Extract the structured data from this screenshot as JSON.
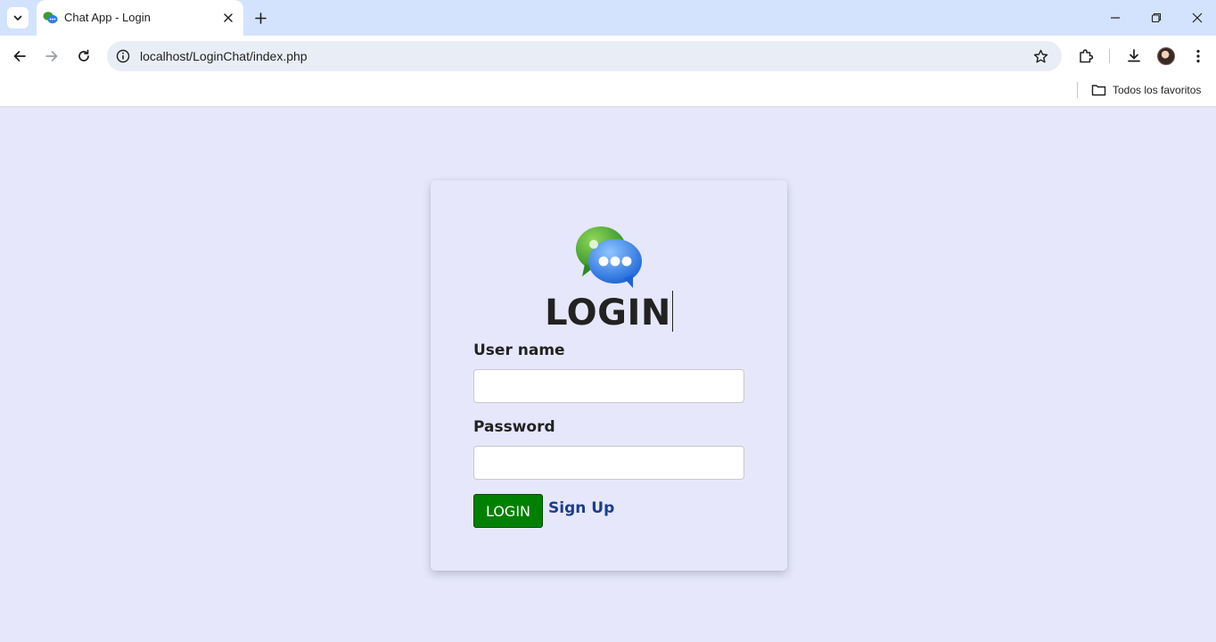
{
  "browser": {
    "tab_title": "Chat App - Login",
    "url": "localhost/LoginChat/index.php",
    "bookmarks_folder": "Todos los favoritos"
  },
  "page": {
    "heading": "LOGIN",
    "username_label": "User name",
    "username_value": "",
    "password_label": "Password",
    "password_value": "",
    "login_button": "LOGIN",
    "signup_link": "Sign Up"
  },
  "colors": {
    "page_background": "#e6e7fb",
    "login_button": "#008000",
    "signup_link": "#1a3e8c"
  },
  "icons": [
    "chevron-down-icon",
    "chat-bubbles-icon",
    "close-icon",
    "plus-icon",
    "minimize-icon",
    "restore-icon",
    "back-arrow-icon",
    "forward-arrow-icon",
    "reload-icon",
    "site-info-icon",
    "star-icon",
    "extensions-icon",
    "download-icon",
    "kebab-menu-icon",
    "folder-icon"
  ]
}
